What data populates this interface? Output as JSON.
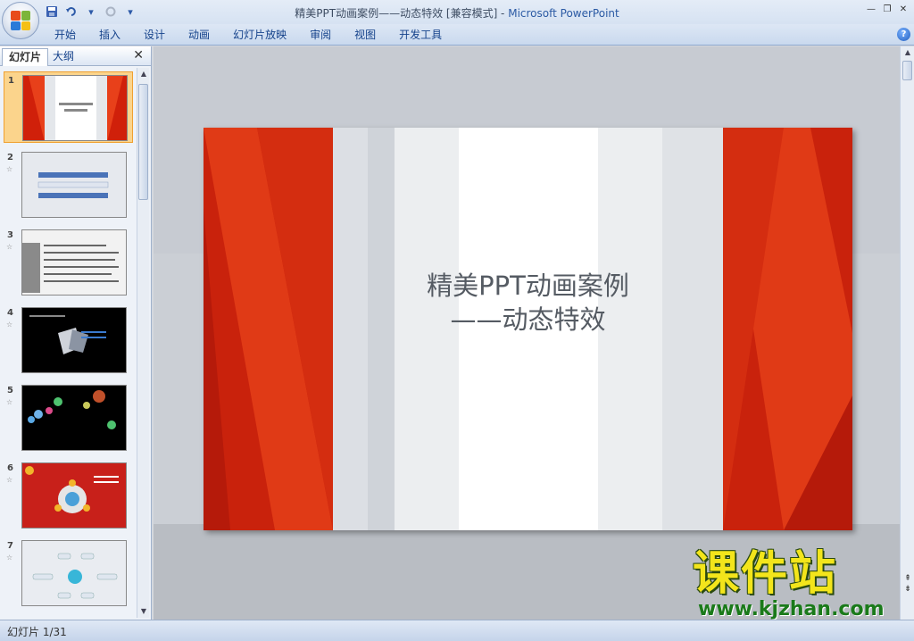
{
  "window": {
    "title_doc": "精美PPT动画案例——动态特效 [兼容模式] - ",
    "title_app": "Microsoft PowerPoint",
    "qat": {
      "undo_dropdown": "▾",
      "more": "▾"
    }
  },
  "ribbon": {
    "tabs": [
      "开始",
      "插入",
      "设计",
      "动画",
      "幻灯片放映",
      "审阅",
      "视图",
      "开发工具"
    ],
    "help": "?"
  },
  "left_pane": {
    "tab_slides": "幻灯片",
    "tab_outline": "大纲",
    "close": "✕",
    "slides": [
      {
        "num": "1",
        "star": ""
      },
      {
        "num": "2",
        "star": "☆"
      },
      {
        "num": "3",
        "star": "☆"
      },
      {
        "num": "4",
        "star": "☆"
      },
      {
        "num": "5",
        "star": "☆"
      },
      {
        "num": "6",
        "star": "☆"
      },
      {
        "num": "7",
        "star": "☆"
      }
    ],
    "selected_slide": 1
  },
  "slide": {
    "title_line1": "精美PPT动画案例",
    "title_line2": "——动态特效"
  },
  "status": {
    "slide_counter": "幻灯片 1/31"
  },
  "watermark": {
    "text": "课件站",
    "url": "www.kjzhan.com"
  },
  "colors": {
    "slide_red": "#d0200a",
    "slide_red_light": "#e8401a",
    "ribbon_blue": "#c9d9ee",
    "selected_thumb": "#fbd48c",
    "watermark_yellow": "#f3e51b"
  }
}
